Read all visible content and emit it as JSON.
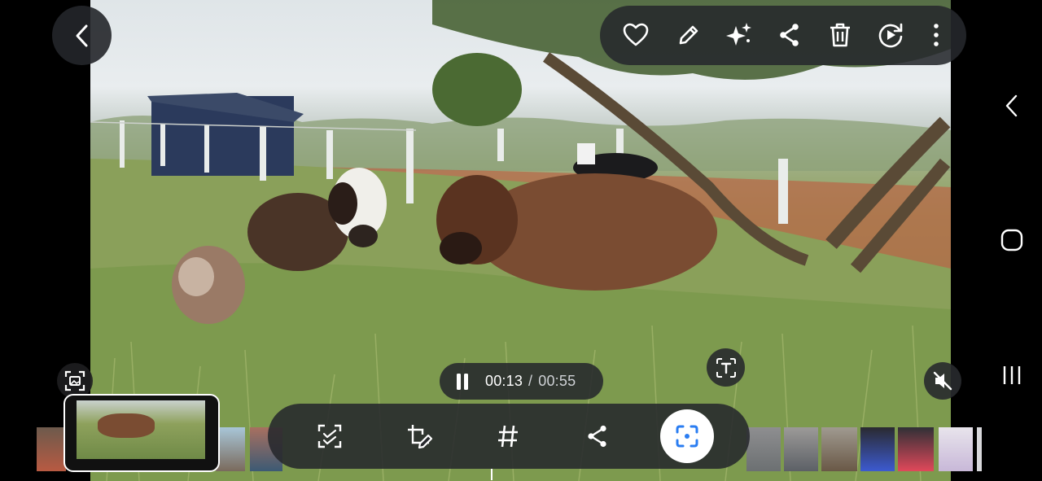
{
  "player": {
    "elapsed": "00:13",
    "separator": "/",
    "duration": "00:55"
  },
  "top_toolbar": {
    "actions": [
      "favorite",
      "edit",
      "ai-enhance",
      "share",
      "delete",
      "remaster",
      "more"
    ]
  },
  "bottom_toolbar": {
    "actions": [
      "capture-frame",
      "crop-edit",
      "hashtag",
      "share",
      "smart-select"
    ]
  },
  "icons": {
    "back": "chevron-left-icon",
    "text_extract": "text-scan-icon",
    "mute": "speaker-muted-icon",
    "screenshot_mode": "image-capture-icon"
  },
  "colors": {
    "toolbar_bg": "#26282c",
    "accent_blue": "#2a7df2",
    "icon_white": "#ffffff"
  }
}
